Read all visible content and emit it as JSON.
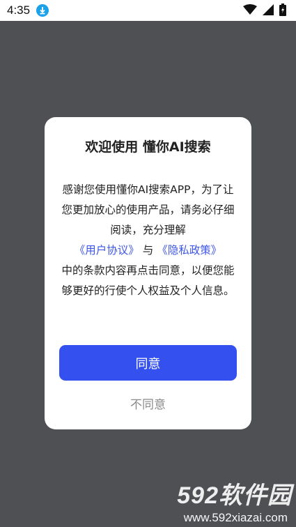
{
  "status_bar": {
    "time": "4:35",
    "icons": [
      "download-icon",
      "wifi-icon",
      "signal-icon",
      "battery-icon"
    ]
  },
  "dialog": {
    "title": "欢迎使用 懂你AI搜索",
    "body_line1": "感谢您使用懂你AI搜索APP，为了让您更加放心的使用产品，请务必仔细阅读，充分理解",
    "user_agreement_link": "《用户协议》",
    "connector": "与",
    "privacy_policy_link": "《隐私政策》",
    "body_line2": "中的条款内容再点击同意，以便您能够更好的行使个人权益及个人信息。",
    "agree_label": "同意",
    "disagree_label": "不同意"
  },
  "watermark": {
    "brand": "592软件园",
    "url": "www.592xiazai.com"
  },
  "colors": {
    "primary": "#3451ef",
    "link": "#3d56e8",
    "scrim": "#4f5054"
  }
}
